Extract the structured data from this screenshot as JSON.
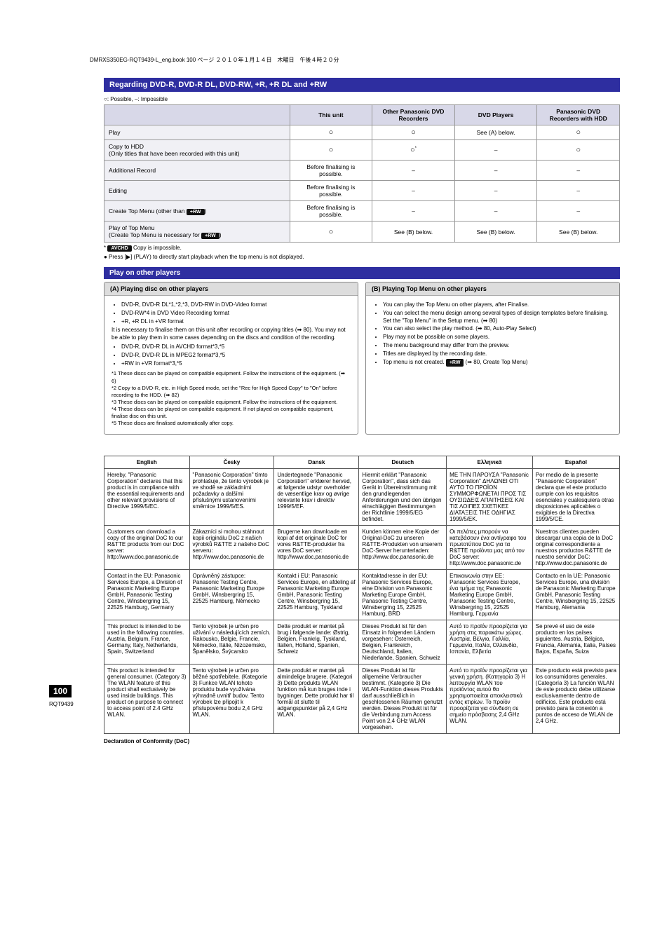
{
  "header_line": "DMRXS350EG-RQT9439-L_eng.book  100 ページ   ２０１０年１月１４日　木曜日　午後４時２０分",
  "section_title": "Regarding DVD-R, DVD-R DL, DVD-RW, +R, +R DL and +RW",
  "possible_note": "○: Possible, –: Impossible",
  "table1": {
    "cols": [
      "",
      "This unit",
      "Other Panasonic DVD Recorders",
      "DVD Players",
      "Panasonic DVD Recorders with HDD"
    ],
    "rows": [
      {
        "label": "Play",
        "cells": [
          "○",
          "○",
          "See (A) below.",
          "○"
        ]
      },
      {
        "label": "Copy to HDD\n(Only titles that have been recorded with this unit)",
        "cells": [
          "○",
          "○*",
          "–",
          "○"
        ]
      },
      {
        "label": "Additional Record",
        "cells": [
          "Before finalising is possible.",
          "–",
          "–",
          "–"
        ]
      },
      {
        "label": "Editing",
        "cells": [
          "Before finalising is possible.",
          "–",
          "–",
          "–"
        ]
      },
      {
        "label": "Create Top Menu (other than <chip>+RW</chip>)",
        "cells": [
          "Before finalising is possible.",
          "–",
          "–",
          "–"
        ]
      },
      {
        "label": "Play of Top Menu\n(Create Top Menu is necessary for <chip>+RW</chip>)",
        "cells": [
          "○",
          "See (B) below.",
          "See (B) below.",
          "See (B) below."
        ]
      }
    ],
    "foot1": "* <chip>AVCHD</chip> Copy is impossible.",
    "foot2": "● Press [▶] (PLAY) to directly start playback when the top menu is not displayed."
  },
  "section2": "Play on other players",
  "left": {
    "title": "(A) Playing disc on other players",
    "bullets1": [
      "DVD-R, DVD-R DL*1,*2,*3, DVD-RW in DVD-Video format",
      "DVD-RW*4 in DVD Video Recording format",
      "+R, +R DL in +VR format"
    ],
    "mid": "It is necessary to finalise them on this unit after recording or copying titles (➡ 80). You may not be able to play them in some cases depending on the discs and condition of the recording.",
    "bullets2": [
      "DVD-R, DVD-R DL in AVCHD format*3,*5",
      "DVD-R, DVD-R DL in MPEG2 format*3,*5",
      "+RW in +VR format*3,*5"
    ],
    "footnotes": [
      "*1 These discs can be played on compatible equipment. Follow the instructions of the equipment. (➡ 6)",
      "*2 Copy to a DVD-R, etc. in High Speed mode, set the \"Rec for High Speed Copy\" to \"On\" before recording to the HDD. (➡ 82)",
      "*3 These discs can be played on compatible equipment. Follow the instructions of the equipment.",
      "*4 These discs can be played on compatible equipment. If not played on compatible equipment, finalise disc on this unit.",
      "*5 These discs are finalised automatically after copy."
    ]
  },
  "right": {
    "title": "(B) Playing Top Menu on other players",
    "bullets": [
      "You can play the Top Menu on other players, after Finalise.",
      "You can select the menu design among several types of design templates before finalising. Set the \"Top Menu\" in the Setup menu. (➡ 80)",
      "You can also select the play method. (➡ 80, Auto-Play Select)",
      "Play may not be possible on some players.",
      "The menu background may differ from the preview.",
      "Titles are displayed by the recording date.",
      "Top menu is not created. <chip>+RW</chip> (➡ 80, Create Top Menu)"
    ]
  },
  "fcc_table": {
    "headers": [
      "English",
      "Česky",
      "Dansk",
      "Deutsch",
      "Ελληνικά",
      "Español"
    ],
    "rows": [
      [
        "Hereby, \"Panasonic Corporation\" declares that this product is in compliance with the essential requirements and other relevant provisions of Directive 1999/5/EC.",
        "\"Panasonic Corporation\" tímto prohlašuje, že tento výrobek je ve shodě se základními požadavky a dalšími příslušnými ustanoveními směrnice 1999/5/ES.",
        "Undertegnede \"Panasonic Corporation\" erklærer herved, at følgende udstyr overholder de væsentlige krav og øvrige relevante krav i direktiv 1999/5/EF.",
        "Hiermit erklärt \"Panasonic Corporation\", dass sich das Gerät in Übereinstimmung mit den grundlegenden Anforderungen und den übrigen einschlägigen Bestimmungen der Richtlinie 1999/5/EG befindet.",
        "ΜΕ ΤΗΝ ΠΑΡΟΥΣΑ \"Panasonic Corporation\" ΔΗΛΩΝΕΙ ΟΤΙ ΑΥΤΟ ΤΟ ΠΡΟΪΟΝ ΣΥΜΜΟΡΦΩΝΕΤΑΙ ΠΡΟΣ ΤΙΣ ΟΥΣΙΩΔΕΙΣ ΑΠΑΙΤΗΣΕΙΣ ΚΑΙ ΤΙΣ ΛΟΙΠΕΣ ΣΧΕΤΙΚΕΣ ΔΙΑΤΑΞΕΙΣ ΤΗΣ ΟΔΗΓΙΑΣ 1999/5/ΕK.",
        "Por medio de la presente \"Panasonic Corporation\" declara que el este producto cumple con los requisitos esenciales y cualesquiera otras disposiciones aplicables o exigibles de la Directiva 1999/5/CE."
      ],
      [
        "Customers can download a copy of the original DoC to our R&TTE products from our DoC server: http://www.doc.panasonic.de",
        "Zákazníci si mohou stáhnout kopii originálu DoC z našich výrobků R&TTE z našeho DoC serveru: http://www.doc.panasonic.de",
        "Brugerne kan downloade en kopi af det originale DoC for vores R&TTE-produkter fra vores DoC server: http://www.doc.panasonic.de",
        "Kunden können eine Kopie der Original-DoC zu unseren R&TTE-Produkten von unserem DoC-Server herunterladen: http://www.doc.panasonic.de",
        "Οι πελάτες μπορούν να κατεβάσουν ένα αντίγραφο του πρωτοτύπου DoC για τα R&TTE προϊόντα μας από τον DoC server: http://www.doc.panasonic.de",
        "Nuestros clientes pueden descargar una copia de la DoC original correspondiente a nuestros productos R&TTE de nuestro servidor DoC: http://www.doc.panasonic.de"
      ],
      [
        "Contact in the EU: Panasonic Services Europe, a Division of Panasonic Marketing Europe GmbH, Panasonic Testing Centre, Winsbergring 15, 22525 Hamburg, Germany",
        "Oprávněný zástupce: Panasonic Testing Centre, Panasonic Marketing Europe GmbH, Winsbergring 15, 22525 Hamburg, Německo",
        "Kontakt i EU: Panasonic Services Europe, en afdeling af Panasonic Marketing Europe GmbH, Panasonic Testing Centre, Winsbergring 15, 22525 Hamburg, Tyskland",
        "Kontaktadresse in der EU: Panasonic Services Europe, eine Division von Panasonic Marketing Europe GmbH, Panasonic Testing Centre, Winsbergring 15, 22525 Hamburg, BRD",
        "Επικοινωνία στην ΕΕ: Panasonic Services Europe, ένα τμήμα της Panasonic Marketing Europe GmbH, Panasonic Testing Centre, Winsbergring 15, 22525 Hamburg, Γερμανία",
        "Contacto en la UE: Panasonic Services Europe, una división de Panasonic Marketing Europe GmbH, Panasonic Testing Centre, Winsbergring 15, 22525 Hamburg, Alemania"
      ],
      [
        "This product is intended to be used in the following countries. Austria, Belgium, France, Germany, Italy, Netherlands, Spain, Switzerland",
        "Tento výrobek je určen pro užívání v následujících zemích. Rakousko, Belgie, Francie, Německo, Itálie, Nizozemsko, Španělsko, Švýcarsko",
        "Dette produkt er møntet på brug i følgende lande: Østrig, Belgien, Frankrig, Tyskland, Italien, Holland, Spanien, Schweiz",
        "Dieses Produkt ist für den Einsatz in folgenden Ländern vorgesehen: Österreich, Belgien, Frankreich, Deutschland, Italien, Niederlande, Spanien, Schweiz",
        "Αυτό το προϊόν προορίζεται για χρήση στις παρακάτω χώρες. Αυστρία, Βέλγιο, Γαλλία, Γερμανία, Ιταλία, Ολλανδία, Ισπανία, Ελβετία",
        "Se prevé el uso de este producto en los países siguientes. Austria, Bélgica, Francia, Alemania, Italia, Países Bajos, España, Suiza"
      ],
      [
        "This product is intended for general consumer. (Category 3) The WLAN feature of this product shall exclusively be used inside buildings. This product on purpose to connect to access point of 2.4 GHz WLAN.",
        "Tento výrobek je určen pro běžné spotřebitele. (Kategorie 3) Funkce WLAN tohoto produktu bude využívána výhradně uvnitř budov. Tento výrobek lze připojit k přístupovému bodu 2,4 GHz WLAN.",
        "Dette produkt er møntet på almindelige brugere. (Kategori 3) Dette produkts WLAN funktion må kun bruges inde i bygninger. Dette produkt har til formål at slutte til adgangspunkter på 2,4 GHz WLAN.",
        "Dieses Produkt ist für allgemeine Verbraucher bestimmt. (Kategorie 3) Die WLAN-Funktion dieses Produkts darf ausschließlich in geschlossenen Räumen genutzt werden. Dieses Produkt ist für die Verbindung zum Access Point von 2,4 GHz WLAN vorgesehen.",
        "Αυτό το προϊόν προορίζεται για γενική χρήση. (Κατηγορία 3) Η λειτουργία WLAN του προϊόντος αυτού θα χρησιμοποιείται αποκλειστικά εντός κτιρίων. Το προϊόν προορίζεται για σύνδεση σε σημείο πρόσβασης 2,4 GHz WLAN.",
        "Este producto está previsto para los consumidores generales. (Categoría 3) La función WLAN de este producto debe utilizarse exclusivamente dentro de edificios. Este producto está previsto para la conexión a puntos de acceso de WLAN de 2,4 GHz."
      ]
    ]
  },
  "footer_title": "Declaration of Conformity (DoC)",
  "page_num": "100",
  "page_sub": "RQT9439"
}
